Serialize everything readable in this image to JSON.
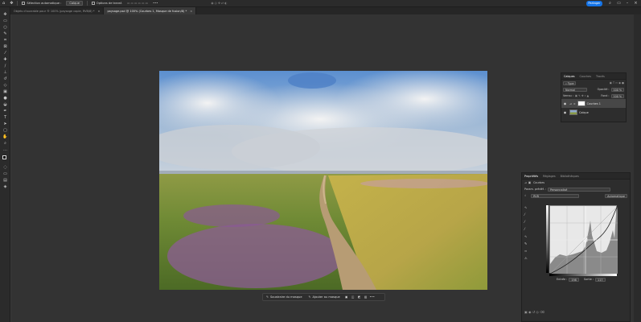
{
  "options_bar": {
    "auto_select_label": "Sélection automatique :",
    "auto_select_value": "Calque",
    "transform_label": "Options de transf.",
    "more": "•••",
    "share_label": "Partager"
  },
  "tabs": [
    {
      "label": "Objets d'ouvrable pour ® 100% (paysage copie, RVB/8) *",
      "active": false,
      "close": "×"
    },
    {
      "label": "paysage.psd @ 100% (Courbes 1, Masque de fusion/8) *",
      "active": true,
      "close": "×"
    }
  ],
  "taskbar": {
    "subtract_label": "Soustraire du masque",
    "add_label": "Ajouter au masque",
    "more": "•••"
  },
  "layers_panel": {
    "tabs": [
      "Calques",
      "Couches",
      "Tracés"
    ],
    "filter_label": "Type",
    "blend_mode": "Normal",
    "opacity_label": "Opacité :",
    "opacity_value": "100 %",
    "lock_label": "Verrou :",
    "fill_label": "Fond :",
    "fill_value": "100 %",
    "layers": [
      {
        "name": "Courbes 1",
        "selected": true
      },
      {
        "name": "Calque",
        "selected": false
      }
    ]
  },
  "properties_panel": {
    "tabs": [
      "Propriétés",
      "Réglages",
      "Bibliothèques"
    ],
    "type_label": "Courbes",
    "preset_label": "Param. prédéf. :",
    "preset_value": "Personnalisé",
    "channel_value": "RVB",
    "auto_label": "Automatique",
    "input_label": "Entrée :",
    "input_value": "198",
    "output_label": "Sortie :",
    "output_value": "117"
  },
  "colors": {
    "accent": "#1473e6",
    "panel_bg": "#2d2d2d",
    "canvas_bg": "#333333"
  }
}
